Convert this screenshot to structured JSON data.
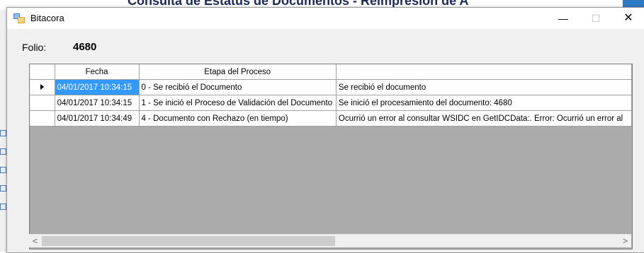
{
  "background_app": {
    "title_partial": "Consulta de Estatus de Documentos - Reimpresión de A"
  },
  "window": {
    "title": "Bitacora",
    "controls": {
      "minimize": "—",
      "maximize": "☐",
      "close": "✕"
    }
  },
  "folio": {
    "label": "Folio:",
    "value": "4680"
  },
  "grid": {
    "columns": [
      "",
      "Fecha",
      "Etapa del Proceso",
      ""
    ],
    "rows": [
      {
        "current": true,
        "fecha": "04/01/2017 10:34:15",
        "etapa": "0 - Se recibió el Documento",
        "detalle": "Se recibió el documento"
      },
      {
        "current": false,
        "fecha": "04/01/2017 10:34:15",
        "etapa": "1 - Se inició el Proceso de Validación del Documento",
        "detalle": "Se inició el procesamiento del documento: 4680"
      },
      {
        "current": false,
        "fecha": "04/01/2017 10:34:49",
        "etapa": "4 - Documento con Rechazo (en tiempo)",
        "detalle": "Ocurrió un error al consultar WSIDC en GetIDCData:. Error: Ocurrió un error al"
      }
    ]
  },
  "scrollbar": {
    "left": "<",
    "right": ">"
  },
  "colors": {
    "selection": "#3399ff",
    "grid_background": "#ababab",
    "window": "#f0f0f0"
  }
}
